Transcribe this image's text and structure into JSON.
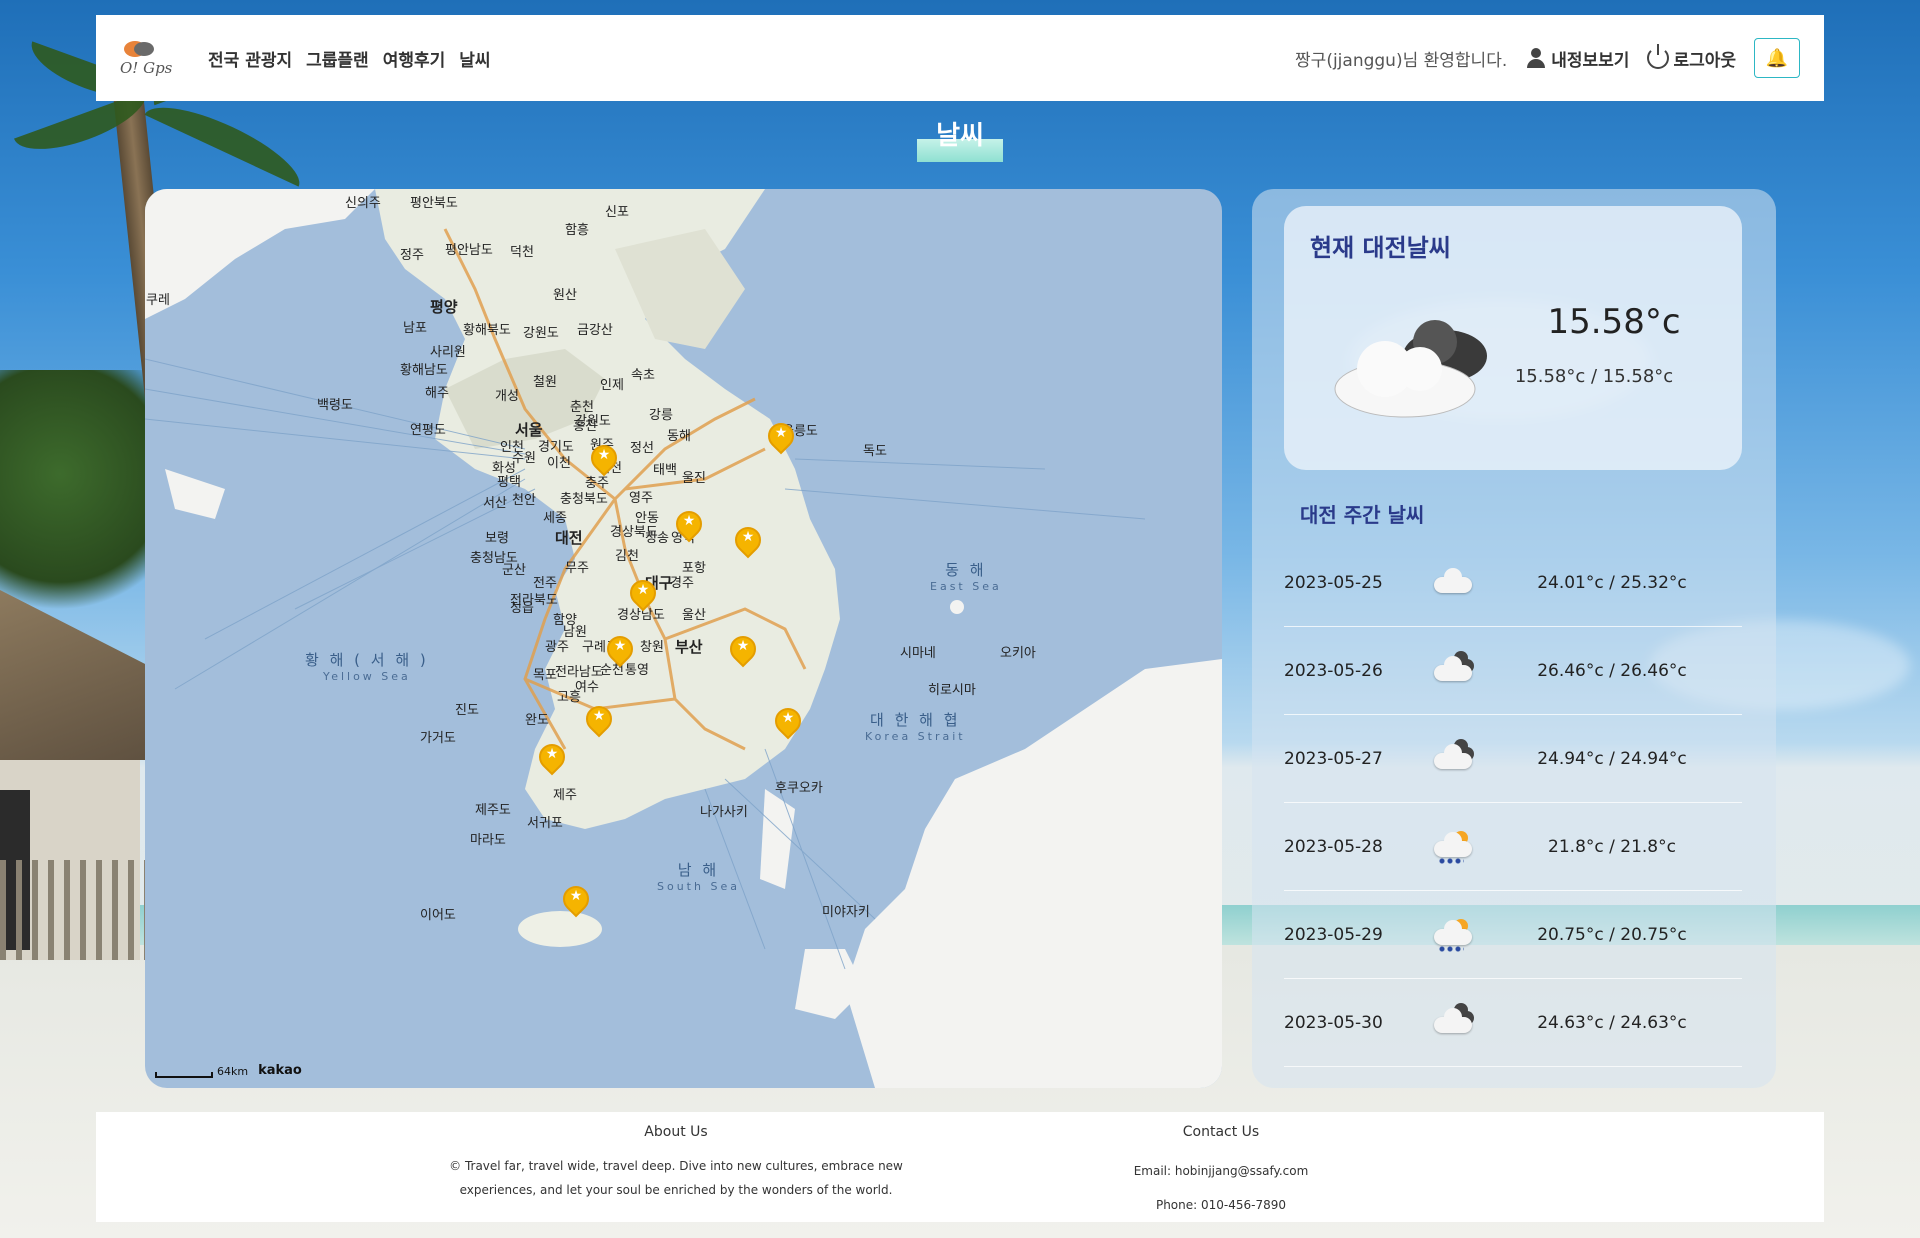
{
  "header": {
    "logo_text": "O! Gps",
    "nav": [
      "전국 관광지",
      "그룹플랜",
      "여행후기",
      "날씨"
    ],
    "welcome": "짱구(jjanggu)님 환영합니다.",
    "my_info": "내정보보기",
    "logout": "로그아웃",
    "bell_icon": "bell-icon"
  },
  "page_title": "날씨",
  "map": {
    "scale_text": "64km",
    "provider": "kakao",
    "seas": [
      {
        "ko": "황 해 ( 서 해 )",
        "en": "Yellow Sea"
      },
      {
        "ko": "동 해",
        "en": "East Sea"
      },
      {
        "ko": "대 한 해 협",
        "en": "Korea Strait"
      },
      {
        "ko": "남 해",
        "en": "South Sea"
      }
    ],
    "labels": [
      {
        "t": "신의주"
      },
      {
        "t": "평안북도"
      },
      {
        "t": "신포"
      },
      {
        "t": "함흥"
      },
      {
        "t": "정주"
      },
      {
        "t": "평안남도"
      },
      {
        "t": "덕천"
      },
      {
        "t": "원산"
      },
      {
        "t": "평양",
        "big": true
      },
      {
        "t": "남포"
      },
      {
        "t": "황해북도"
      },
      {
        "t": "강원도"
      },
      {
        "t": "금강산"
      },
      {
        "t": "사리원"
      },
      {
        "t": "황해남도"
      },
      {
        "t": "속초"
      },
      {
        "t": "해주"
      },
      {
        "t": "개성"
      },
      {
        "t": "철원"
      },
      {
        "t": "인제"
      },
      {
        "t": "백령도"
      },
      {
        "t": "춘천"
      },
      {
        "t": "강원도"
      },
      {
        "t": "강릉"
      },
      {
        "t": "연평도"
      },
      {
        "t": "서울",
        "big": true
      },
      {
        "t": "홍천"
      },
      {
        "t": "동해"
      },
      {
        "t": "인천"
      },
      {
        "t": "경기도"
      },
      {
        "t": "원주"
      },
      {
        "t": "정선"
      },
      {
        "t": "울릉도"
      },
      {
        "t": "독도"
      },
      {
        "t": "화성"
      },
      {
        "t": "수원"
      },
      {
        "t": "이천"
      },
      {
        "t": "제천"
      },
      {
        "t": "태백"
      },
      {
        "t": "평택"
      },
      {
        "t": "충주"
      },
      {
        "t": "울진"
      },
      {
        "t": "서산"
      },
      {
        "t": "천안"
      },
      {
        "t": "충청북도"
      },
      {
        "t": "영주"
      },
      {
        "t": "세종"
      },
      {
        "t": "안동"
      },
      {
        "t": "보령"
      },
      {
        "t": "대전",
        "big": true
      },
      {
        "t": "경상북도"
      },
      {
        "t": "청송"
      },
      {
        "t": "영덕"
      },
      {
        "t": "충청남도"
      },
      {
        "t": "김천"
      },
      {
        "t": "군산"
      },
      {
        "t": "무주"
      },
      {
        "t": "포항"
      },
      {
        "t": "전주"
      },
      {
        "t": "대구",
        "big": true
      },
      {
        "t": "경주"
      },
      {
        "t": "전라북도"
      },
      {
        "t": "정읍"
      },
      {
        "t": "울산"
      },
      {
        "t": "함양"
      },
      {
        "t": "남원"
      },
      {
        "t": "경상남도"
      },
      {
        "t": "광주"
      },
      {
        "t": "구례"
      },
      {
        "t": "진주"
      },
      {
        "t": "창원"
      },
      {
        "t": "부산",
        "big": true
      },
      {
        "t": "목포"
      },
      {
        "t": "전라남도"
      },
      {
        "t": "순천"
      },
      {
        "t": "여수"
      },
      {
        "t": "통영"
      },
      {
        "t": "고흥"
      },
      {
        "t": "진도"
      },
      {
        "t": "완도"
      },
      {
        "t": "가거도"
      },
      {
        "t": "제주"
      },
      {
        "t": "제주도"
      },
      {
        "t": "서귀포"
      },
      {
        "t": "마라도"
      },
      {
        "t": "이어도"
      },
      {
        "t": "시마네"
      },
      {
        "t": "오키아"
      },
      {
        "t": "히로시마"
      },
      {
        "t": "후쿠오카"
      },
      {
        "t": "나가사키"
      },
      {
        "t": "미야자키"
      },
      {
        "t": "쿠레"
      }
    ]
  },
  "current_weather": {
    "title": "현재 대전날씨",
    "temp": "15.58°c",
    "range": "15.58°c / 15.58°c",
    "icon": "cloudy-icon"
  },
  "weekly": {
    "title": "대전 주간 날씨",
    "days": [
      {
        "date": "2023-05-25",
        "temps": "24.01°c / 25.32°c",
        "icon": "cloud-icon"
      },
      {
        "date": "2023-05-26",
        "temps": "26.46°c / 26.46°c",
        "icon": "cloudy-icon"
      },
      {
        "date": "2023-05-27",
        "temps": "24.94°c / 24.94°c",
        "icon": "cloudy-icon"
      },
      {
        "date": "2023-05-28",
        "temps": "21.8°c / 21.8°c",
        "icon": "rain-sun-icon"
      },
      {
        "date": "2023-05-29",
        "temps": "20.75°c / 20.75°c",
        "icon": "rain-sun-icon"
      },
      {
        "date": "2023-05-30",
        "temps": "24.63°c / 24.63°c",
        "icon": "cloudy-icon"
      }
    ]
  },
  "footer": {
    "about_title": "About Us",
    "about_text_1": "© Travel far, travel wide, travel deep. Dive into new cultures, embrace new",
    "about_text_2": "experiences, and let your soul be enriched by the wonders of the world.",
    "contact_title": "Contact Us",
    "email": "Email: hobinjjang@ssafy.com",
    "phone": "Phone: 010-456-7890"
  }
}
